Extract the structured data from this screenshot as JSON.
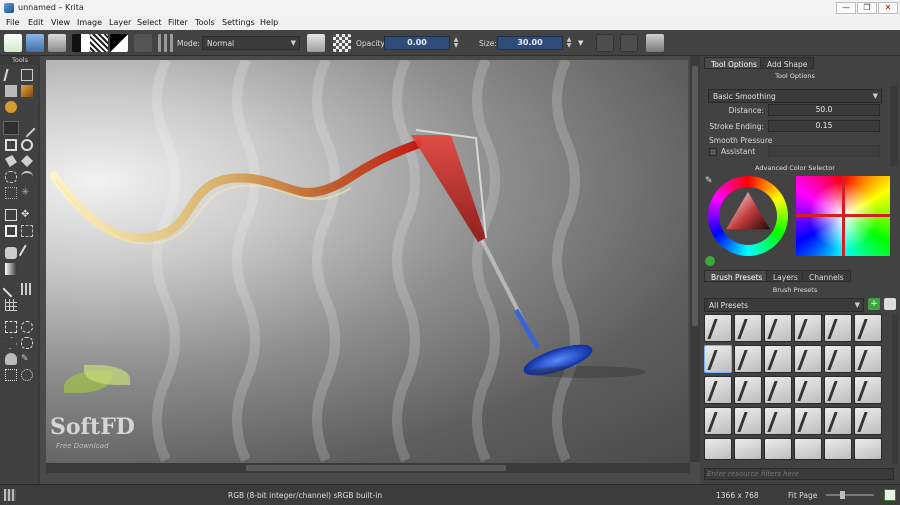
{
  "window": {
    "title": "unnamed – Krita",
    "minimize": "—",
    "maximize": "❐",
    "close": "✕"
  },
  "menu": [
    "File",
    "Edit",
    "View",
    "Image",
    "Layer",
    "Select",
    "Filter",
    "Tools",
    "Settings",
    "Help"
  ],
  "toolbar": {
    "mode_label": "Mode:",
    "mode_value": "Normal",
    "opacity_label": "Opacity:",
    "opacity_value": "0.00",
    "size_label": "Size:",
    "size_value": "30.00"
  },
  "tools_label": "Tools",
  "tool_options": {
    "tabs": [
      "Tool Options",
      "Add Shape"
    ],
    "title": "Tool Options",
    "smoothing": "Basic Smoothing",
    "distance_label": "Distance:",
    "distance_value": "50.0",
    "stroke_ending_label": "Stroke Ending:",
    "stroke_ending_value": "0.15",
    "smooth_pressure": "Smooth Pressure",
    "assistant": "Assistant"
  },
  "color_selector": {
    "title": "Advanced Color Selector"
  },
  "brush_presets": {
    "tabs": [
      "Brush Presets",
      "Layers",
      "Channels"
    ],
    "title": "Brush Presets",
    "filter": "All Presets",
    "search_placeholder": "Enter resource filters here"
  },
  "status": {
    "color_info": "RGB (8-bit integer/channel)  sRGB built-in",
    "dimensions": "1366 x 768",
    "zoom": "Fit Page"
  },
  "watermark": {
    "name": "SoftFD",
    "tagline": "Free Download"
  },
  "colors": {
    "accent": "#2f4c78",
    "panel": "#424242",
    "toolbar": "#434343"
  }
}
